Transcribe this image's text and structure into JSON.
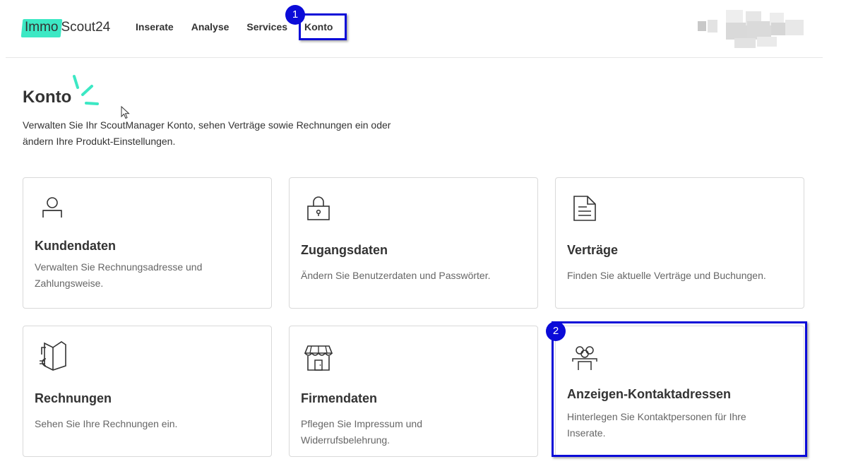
{
  "header": {
    "logo": {
      "part1": "Immo",
      "part2": "Scout24"
    },
    "nav": [
      {
        "label": "Inserate"
      },
      {
        "label": "Analyse"
      },
      {
        "label": "Services"
      },
      {
        "label": "Konto"
      }
    ]
  },
  "annotations": {
    "badge1": "1",
    "badge2": "2",
    "highlight_color": "#0b0bd8"
  },
  "page": {
    "title": "Konto",
    "subtitle": "Verwalten Sie Ihr ScoutManager Konto, sehen Verträge sowie Rechnungen ein oder ändern Ihre Produkt-Einstellungen."
  },
  "cards": [
    {
      "icon": "person-icon",
      "title": "Kundendaten",
      "description": "Verwalten Sie Rechnungsadresse und Zahlungsweise."
    },
    {
      "icon": "lock-icon",
      "title": "Zugangsdaten",
      "description": "Ändern Sie Benutzerdaten und Passwörter."
    },
    {
      "icon": "document-icon",
      "title": "Verträge",
      "description": "Finden Sie aktuelle Verträge und Buchungen."
    },
    {
      "icon": "invoice-euro-icon",
      "title": "Rechnungen",
      "description": "Sehen Sie Ihre Rechnungen ein."
    },
    {
      "icon": "storefront-icon",
      "title": "Firmendaten",
      "description": "Pflegen Sie Impressum und Widerrufsbelehrung."
    },
    {
      "icon": "contact-group-icon",
      "title": "Anzeigen-Kontaktadressen",
      "description": "Hinterlegen Sie Kontaktpersonen für Ihre Inserate."
    }
  ],
  "colors": {
    "accent": "#3ce8c4",
    "text": "#333333",
    "muted": "#666666",
    "border": "#d9d9d9"
  }
}
